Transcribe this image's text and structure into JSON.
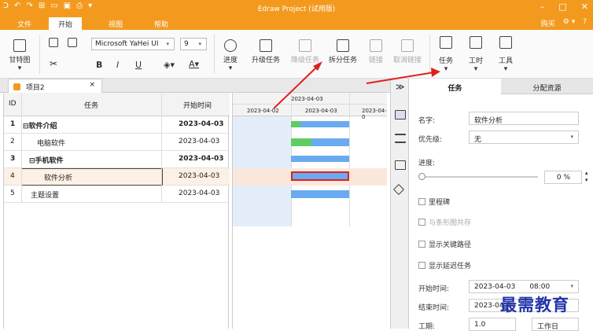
{
  "app": {
    "title": "Edraw Project (试用版)"
  },
  "menu": {
    "file": "文件",
    "start": "开始",
    "view": "视图",
    "help": "帮助",
    "buy": "购买",
    "settings": "⚙ ▾",
    "help_icon": "?"
  },
  "ribbon": {
    "gantt": "甘特图",
    "font_name": "Microsoft YaHei UI",
    "font_size": "9",
    "bold": "B",
    "italic": "I",
    "underline": "U",
    "progress": "进度",
    "upgrade": "升级任务",
    "downgrade": "降级任务",
    "split": "拆分任务",
    "link": "链接",
    "unlink": "取消链接",
    "task": "任务",
    "hours": "工时",
    "tools": "工具"
  },
  "document_tab": {
    "label": "项目2",
    "close": "×"
  },
  "grid": {
    "headers": {
      "id": "ID",
      "task": "任务",
      "start": "开始时间"
    },
    "rows": [
      {
        "id": "1",
        "name": "⊟软件介绍",
        "start": "2023-04-03"
      },
      {
        "id": "2",
        "name": "电脑软件",
        "start": "2023-04-03"
      },
      {
        "id": "3",
        "name": "⊟手机软件",
        "start": "2023-04-03"
      },
      {
        "id": "4",
        "name": "软件分析",
        "start": "2023-04-03"
      },
      {
        "id": "5",
        "name": "主题设置",
        "start": "2023-04-03"
      }
    ]
  },
  "gantt": {
    "top_date": "2023-04-03",
    "dates": [
      "2023-04-02",
      "2023-04-03",
      "2023-04-0"
    ]
  },
  "panel": {
    "collapse": "≫",
    "tab_task": "任务",
    "tab_resource": "分配资源",
    "name_label": "名字:",
    "name_value": "软件分析",
    "priority_label": "优先级:",
    "priority_value": "无",
    "progress_label": "进度:",
    "progress_value": "0 %",
    "milestone": "里程碑",
    "coexist": "与条形图共存",
    "critical": "显示关键路径",
    "delay": "显示延迟任务",
    "start_label": "开始时间:",
    "start_date": "2023-04-03",
    "start_time": "08:00",
    "end_label": "结束时间:",
    "end_date": "2023-04-0",
    "duration_label": "工期:",
    "duration_value": "1.0",
    "duration_unit": "工作日"
  },
  "watermark": "最需教育",
  "colors": {
    "accent": "#f39a1e",
    "bar_blue": "#6aaaf0",
    "bar_green": "#62cc62",
    "annotation_red": "#e02020"
  }
}
